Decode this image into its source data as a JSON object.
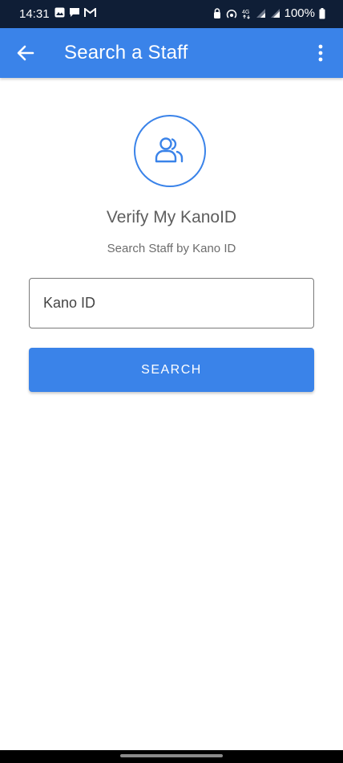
{
  "status_bar": {
    "time": "14:31",
    "battery": "100%"
  },
  "appbar": {
    "title": "Search a Staff",
    "background": "#3a83e9"
  },
  "icons": {
    "back": "arrow-left-icon",
    "menu": "more-vert-icon",
    "avatar": "users-icon"
  },
  "main": {
    "heading": "Verify My KanoID",
    "subheading": "Search Staff by Kano ID",
    "input": {
      "placeholder": "Kano ID",
      "value": ""
    },
    "search_label": "SEARCH"
  },
  "colors": {
    "accent": "#3a83e9",
    "status_bar": "#0f1e36"
  }
}
